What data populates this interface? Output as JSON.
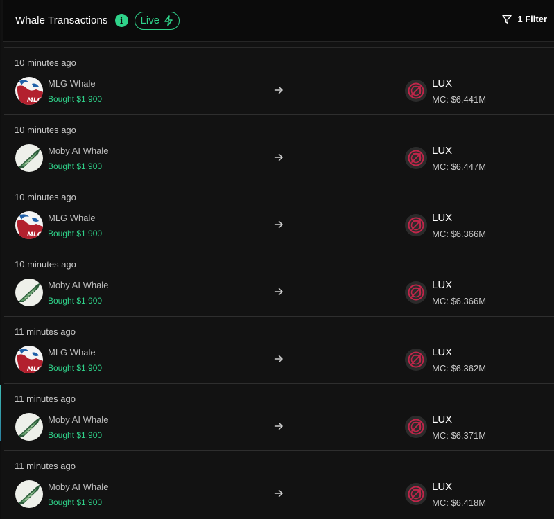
{
  "header": {
    "title": "Whale Transactions",
    "info_icon": "info-icon",
    "live_label": "Live",
    "filter_label": "1 Filter"
  },
  "colors": {
    "accent_green": "#2fd38a",
    "background": "#121212",
    "token_red": "#c0264a"
  },
  "transactions": [
    {
      "time": "10 minutes ago",
      "whale": "MLG Whale",
      "avatar": "mlg",
      "action": "Bought $1,900",
      "token": "LUX",
      "mc": "MC: $6.441M"
    },
    {
      "time": "10 minutes ago",
      "whale": "Moby AI Whale",
      "avatar": "moby",
      "action": "Bought $1,900",
      "token": "LUX",
      "mc": "MC: $6.447M"
    },
    {
      "time": "10 minutes ago",
      "whale": "MLG Whale",
      "avatar": "mlg",
      "action": "Bought $1,900",
      "token": "LUX",
      "mc": "MC: $6.366M"
    },
    {
      "time": "10 minutes ago",
      "whale": "Moby AI Whale",
      "avatar": "moby",
      "action": "Bought $1,900",
      "token": "LUX",
      "mc": "MC: $6.366M"
    },
    {
      "time": "11 minutes ago",
      "whale": "MLG Whale",
      "avatar": "mlg",
      "action": "Bought $1,900",
      "token": "LUX",
      "mc": "MC: $6.362M"
    },
    {
      "time": "11 minutes ago",
      "whale": "Moby AI Whale",
      "avatar": "moby",
      "action": "Bought $1,900",
      "token": "LUX",
      "mc": "MC: $6.371M"
    },
    {
      "time": "11 minutes ago",
      "whale": "Moby AI Whale",
      "avatar": "moby",
      "action": "Bought $1,900",
      "token": "LUX",
      "mc": "MC: $6.418M"
    }
  ]
}
